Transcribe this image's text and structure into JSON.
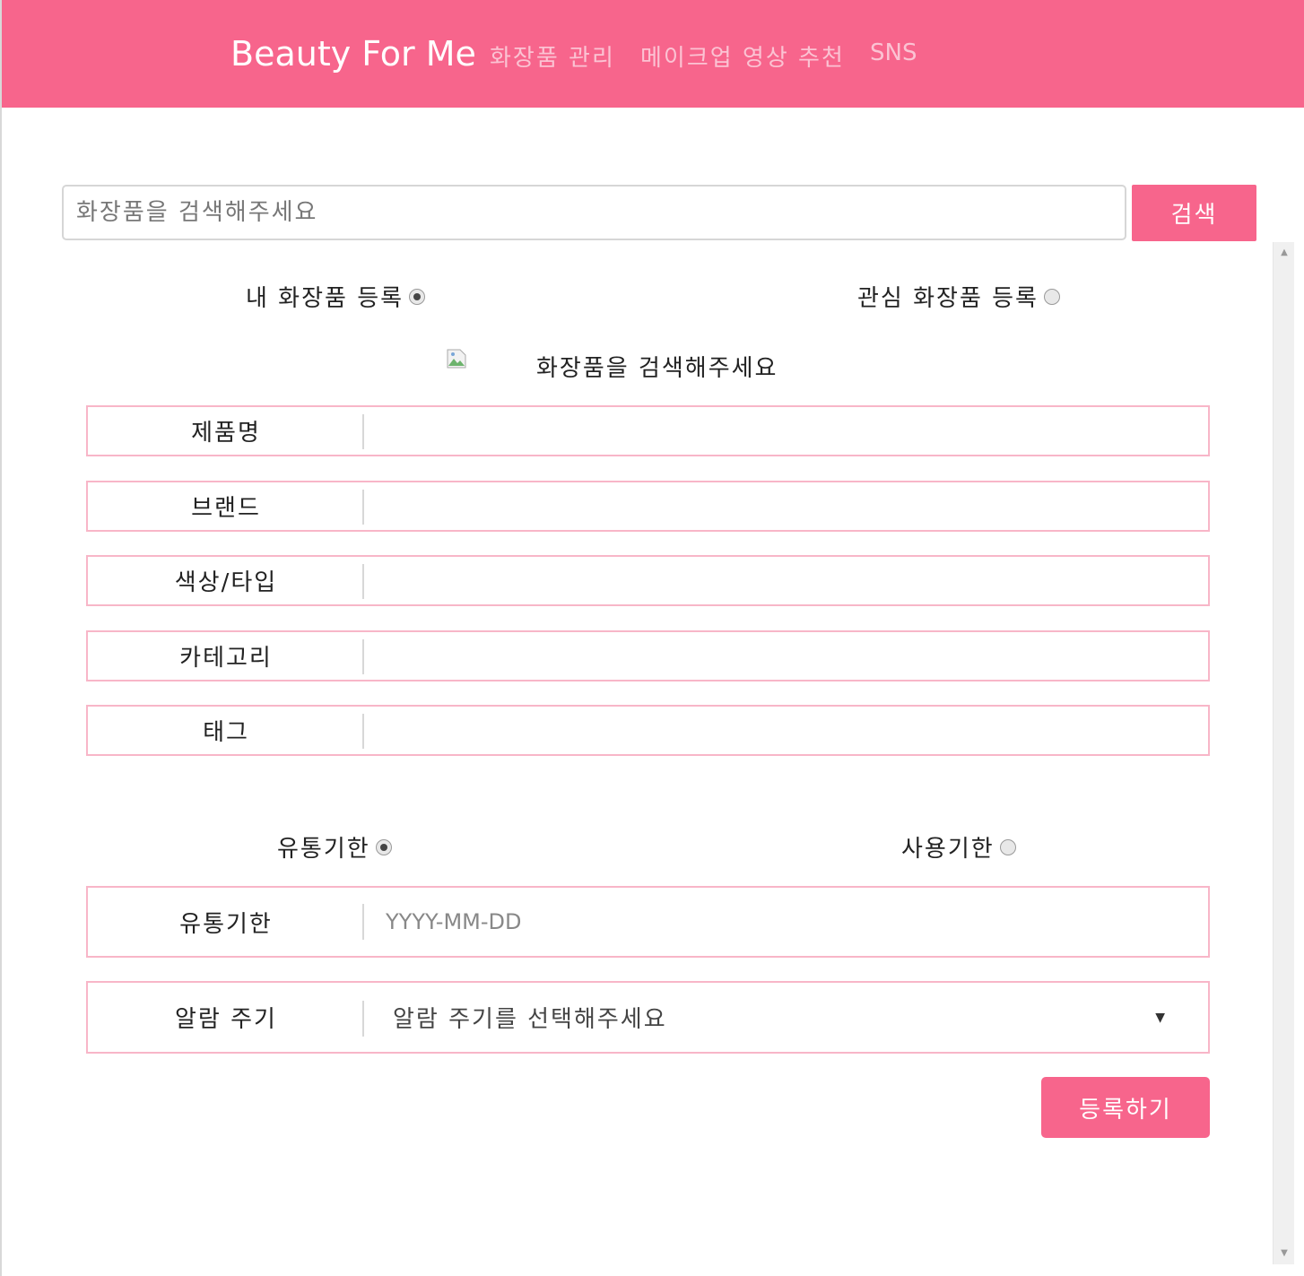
{
  "navbar": {
    "brand": "Beauty For Me",
    "links": [
      "화장품 관리",
      "메이크업 영상 추천",
      "SNS"
    ]
  },
  "search": {
    "placeholder": "화장품을 검색해주세요",
    "button_label": "검색"
  },
  "register_type": {
    "options": [
      {
        "label": "내 화장품 등록",
        "checked": true
      },
      {
        "label": "관심 화장품 등록",
        "checked": false
      }
    ]
  },
  "preview": {
    "caption": "화장품을 검색해주세요"
  },
  "fields": [
    {
      "label": "제품명",
      "value": ""
    },
    {
      "label": "브랜드",
      "value": ""
    },
    {
      "label": "색상/타입",
      "value": ""
    },
    {
      "label": "카테고리",
      "value": ""
    },
    {
      "label": "태그",
      "value": ""
    }
  ],
  "date_type": {
    "options": [
      {
        "label": "유통기한",
        "checked": true
      },
      {
        "label": "사용기한",
        "checked": false
      }
    ]
  },
  "expiry": {
    "label": "유통기한",
    "placeholder": "YYYY-MM-DD"
  },
  "alarm": {
    "label": "알람 주기",
    "selected": "알람 주기를 선택해주세요"
  },
  "submit_label": "등록하기",
  "colors": {
    "accent": "#f7658c",
    "border": "#f8b6c8",
    "nav_link": "#fbc3d3"
  }
}
